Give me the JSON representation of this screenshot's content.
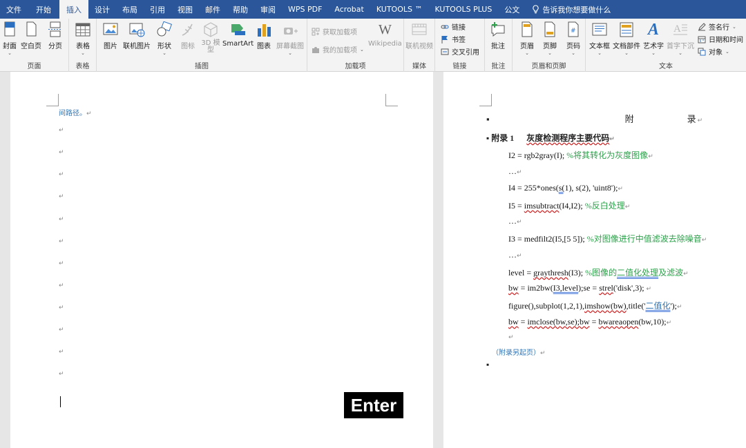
{
  "menubar": {
    "tabs": [
      "文件",
      "开始",
      "插入",
      "设计",
      "布局",
      "引用",
      "视图",
      "邮件",
      "帮助",
      "审阅",
      "WPS PDF",
      "Acrobat",
      "KUTOOLS ™",
      "KUTOOLS PLUS",
      "公文"
    ],
    "active_index": 2,
    "tell_me": "告诉我你想要做什么"
  },
  "ribbon": {
    "groups": {
      "pages": "页面",
      "tables": "表格",
      "illustrations": "插图",
      "addins": "加载项",
      "media": "媒体",
      "links": "链接",
      "comments": "批注",
      "header_footer": "页眉和页脚",
      "text": "文本"
    },
    "buttons": {
      "cover": "封面",
      "blank_page": "空白页",
      "page_break": "分页",
      "table": "表格",
      "picture": "图片",
      "online_picture": "联机图片",
      "shapes": "形状",
      "icons": "图标",
      "model_3d": "3D 模型",
      "smartart": "SmartArt",
      "chart": "图表",
      "screenshot": "屏幕截图",
      "get_addins": "获取加载项",
      "my_addins": "我的加载项",
      "wikipedia": "Wikipedia",
      "online_video": "联机视频",
      "link": "链接",
      "bookmark": "书签",
      "cross_reference": "交叉引用",
      "comment": "批注",
      "header": "页眉",
      "footer": "页脚",
      "page_number": "页码",
      "text_box": "文本框",
      "quick_parts": "文档部件",
      "wordart": "艺术字",
      "drop_cap": "首字下沉",
      "signature_line": "签名行",
      "date_time": "日期和时间",
      "object": "对象"
    }
  },
  "left_page": {
    "top_text": "间路径。"
  },
  "right_page": {
    "title": "附　　　　　录",
    "heading": {
      "prefix": "附录 1",
      "text": "灰度检测程序主要代码"
    },
    "code": {
      "l1": {
        "code": "I2 = rgb2gray(I); ",
        "comment": "%将其转化为灰度图像"
      },
      "l2": "…",
      "l3": {
        "a": "I4 = 255*ones(",
        "b": "s(",
        "c": "1), s(2), 'uint8');"
      },
      "l4": {
        "a": "I5 = ",
        "b": "imsubtract",
        "c": "(I4,I2); ",
        "comment": "%反白处理"
      },
      "l5": "…",
      "l6": {
        "code": "I3 = medfilt2(I5,[5 5]); ",
        "comment": "%对图像进行中值滤波去除噪音"
      },
      "l7": "…",
      "l8": {
        "a": "level = ",
        "b": "graythresh",
        "c": "(I3); ",
        "comment1": "%图像的",
        "comment2": "二值化处理",
        "comment3": "及滤波"
      },
      "l9": {
        "a": "bw",
        "b": " = im2bw(",
        "c": "I3,level",
        "d": ");se = ",
        "e": "strel",
        "f": "('disk',3); "
      },
      "l10": {
        "a": "figure(),subplot(1,2,1),",
        "b": "imshow(bw)",
        "c": ",title('",
        "d": "二值化",
        "e": "');"
      },
      "l11": {
        "a": "bw",
        "b": " = ",
        "c": "imclose(bw,se);bw",
        "d": " = ",
        "e": "bwareaopen",
        "f": "(bw,10);"
      }
    },
    "caption": "（附录另起页）"
  },
  "overlay": {
    "enter_key": "Enter"
  },
  "colors": {
    "brand": "#2b579a",
    "comment_green": "#2ca24a",
    "caption_blue": "#2e74b5"
  }
}
